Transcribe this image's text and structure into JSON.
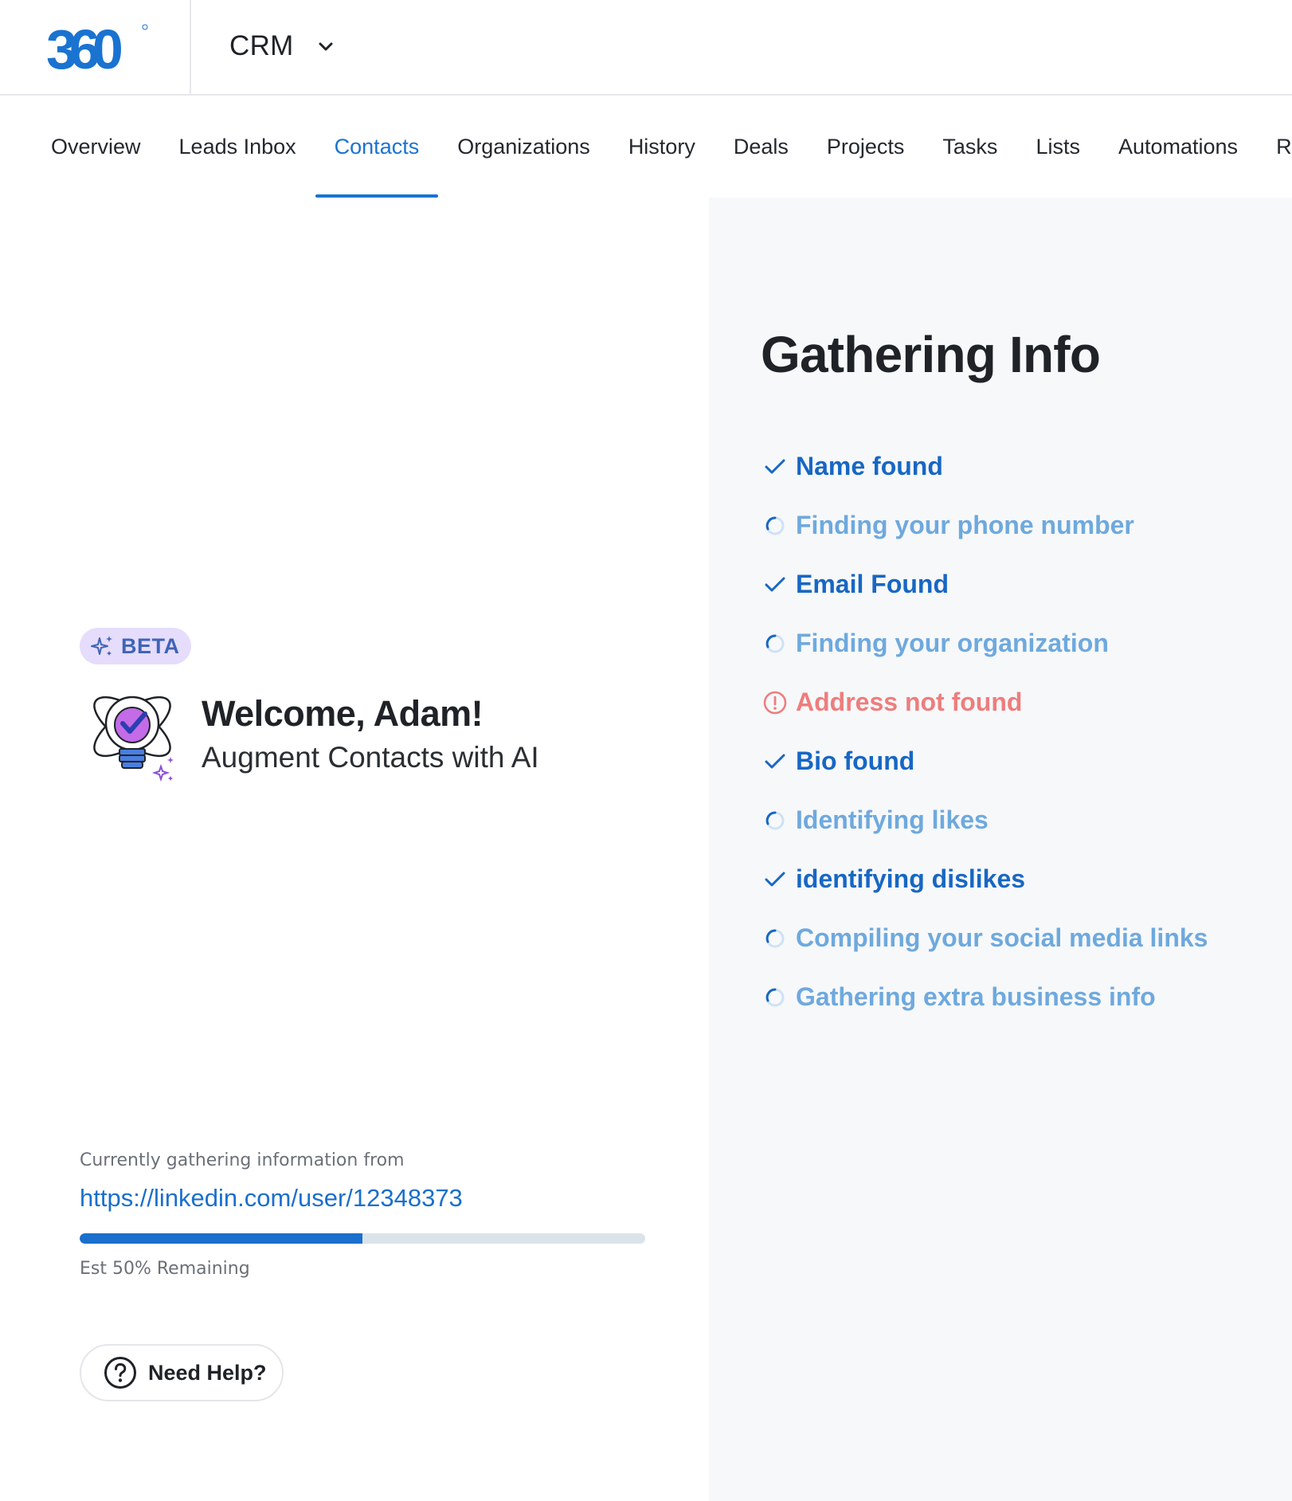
{
  "header": {
    "logo_text": "360",
    "app_name": "CRM"
  },
  "tabs": [
    {
      "label": "Overview",
      "active": false
    },
    {
      "label": "Leads Inbox",
      "active": false
    },
    {
      "label": "Contacts",
      "active": true
    },
    {
      "label": "Organizations",
      "active": false
    },
    {
      "label": "History",
      "active": false
    },
    {
      "label": "Deals",
      "active": false
    },
    {
      "label": "Projects",
      "active": false
    },
    {
      "label": "Tasks",
      "active": false
    },
    {
      "label": "Lists",
      "active": false
    },
    {
      "label": "Automations",
      "active": false
    },
    {
      "label": "Re",
      "active": false
    }
  ],
  "welcome": {
    "badge": "BETA",
    "title": "Welcome, Adam!",
    "subtitle": "Augment Contacts with AI"
  },
  "gathering": {
    "label": "Currently gathering information from",
    "url": "https://linkedin.com/user/12348373",
    "progress_fraction": 0.5,
    "remaining": "Est 50% Remaining"
  },
  "help": {
    "label": "Need Help?"
  },
  "info_panel": {
    "title": "Gathering Info",
    "steps": [
      {
        "label": "Name found",
        "status": "done"
      },
      {
        "label": "Finding your phone number",
        "status": "loading"
      },
      {
        "label": "Email Found",
        "status": "done"
      },
      {
        "label": "Finding your organization",
        "status": "loading"
      },
      {
        "label": "Address not found",
        "status": "error"
      },
      {
        "label": "Bio found",
        "status": "done"
      },
      {
        "label": "Identifying likes",
        "status": "loading"
      },
      {
        "label": "identifying dislikes",
        "status": "done"
      },
      {
        "label": "Compiling your social media links",
        "status": "loading"
      },
      {
        "label": "Gathering extra business info",
        "status": "loading"
      }
    ]
  },
  "colors": {
    "accent": "#1a73d1",
    "done": "#1767c4",
    "loading": "#6ea9de",
    "error": "#ee7d7d",
    "beta_bg": "#e6dcfb"
  },
  "icons": {
    "chevron": "chevron-down-icon",
    "sparkle": "sparkle-icon",
    "bulb": "ai-lightbulb-icon",
    "help": "question-circle-icon",
    "done": "check-icon",
    "loading": "spinner-icon",
    "error": "alert-circle-icon"
  }
}
